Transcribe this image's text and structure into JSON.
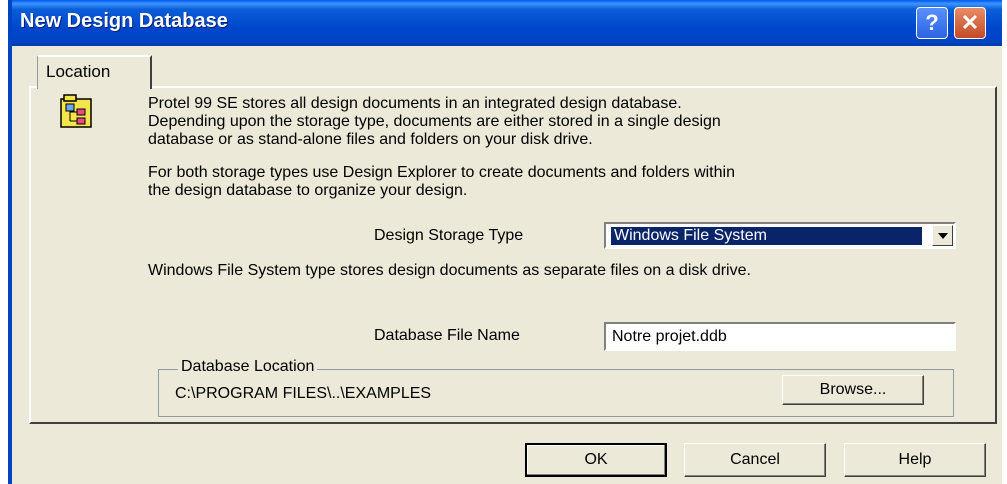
{
  "window": {
    "title": "New Design Database",
    "help_button": "?",
    "close_button": "✕"
  },
  "tabs": [
    {
      "label": "Location"
    }
  ],
  "description": {
    "line1": "Protel 99 SE stores all design documents in an integrated design database.",
    "line2": "Depending upon the storage type, documents are either stored in a single design",
    "line3": "database or as stand-alone files and folders on your disk drive.",
    "line4": "For both storage types use Design Explorer to create documents and folders within",
    "line5": "the design database to organize your design."
  },
  "storage_type": {
    "label": "Design Storage Type",
    "value": "Windows File System",
    "note": "Windows File System type stores design documents as separate files on a disk drive."
  },
  "file_name": {
    "label": "Database File Name",
    "value": "Notre projet.ddb"
  },
  "location": {
    "group_label": "Database Location",
    "path": "C:\\PROGRAM FILES\\..\\EXAMPLES",
    "browse_label": "Browse..."
  },
  "buttons": {
    "ok": "OK",
    "cancel": "Cancel",
    "help": "Help"
  },
  "colors": {
    "titlebar": "#0a5ed8",
    "dialog_bg": "#ece9d8",
    "selection": "#0a246a",
    "close": "#c24a24"
  }
}
